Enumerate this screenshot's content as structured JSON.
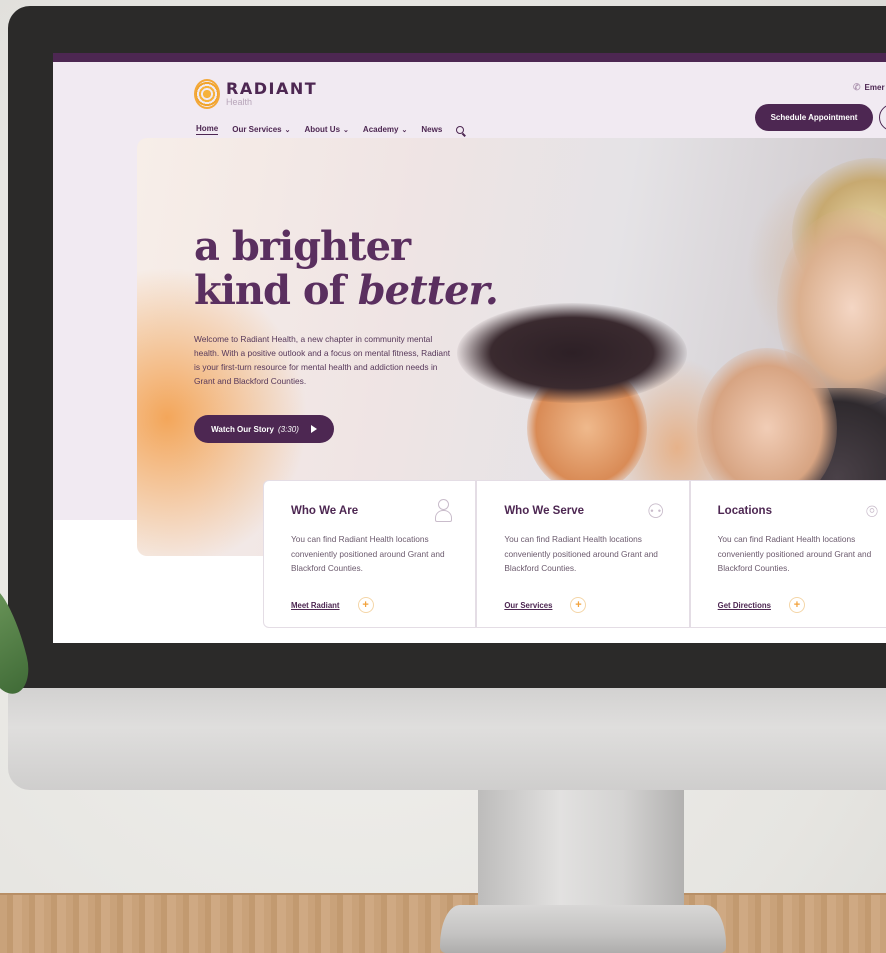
{
  "header": {
    "logo": {
      "name": "RADIANT",
      "sub": "Health"
    },
    "nav": [
      {
        "label": "Home"
      },
      {
        "label": "Our Services"
      },
      {
        "label": "About Us"
      },
      {
        "label": "Academy"
      },
      {
        "label": "News"
      }
    ],
    "emergency_label": "Emer",
    "schedule_label": "Schedule Appointment"
  },
  "hero": {
    "headline_line1": "a brighter",
    "headline_line2_plain": "kind of ",
    "headline_line2_emph": "better.",
    "intro": "Welcome to Radiant Health, a new chapter in community mental health. With a positive outlook and a focus on mental fitness, Radiant is your first-turn resource for mental health and addiction needs in Grant and Blackford Counties.",
    "watch_label": "Watch Our Story",
    "watch_duration": "(3:30)"
  },
  "cards": [
    {
      "title": "Who We Are",
      "text": "You can find Radiant Health locations conveniently positioned around Grant and Blackford Counties.",
      "link": "Meet Radiant",
      "icon": "person-icon"
    },
    {
      "title": "Who We Serve",
      "text": "You can find Radiant Health locations conveniently positioned around Grant and Blackford Counties.",
      "link": "Our Services",
      "icon": "people-icon"
    },
    {
      "title": "Locations",
      "text": "You can find Radiant Health locations conveniently positioned around Grant and Blackford Counties.",
      "link": "Get Directions",
      "icon": "map-pin-icon"
    }
  ],
  "colors": {
    "brand": "#4d2752",
    "accent": "#f2a23c",
    "tint": "#f1eaf2"
  }
}
